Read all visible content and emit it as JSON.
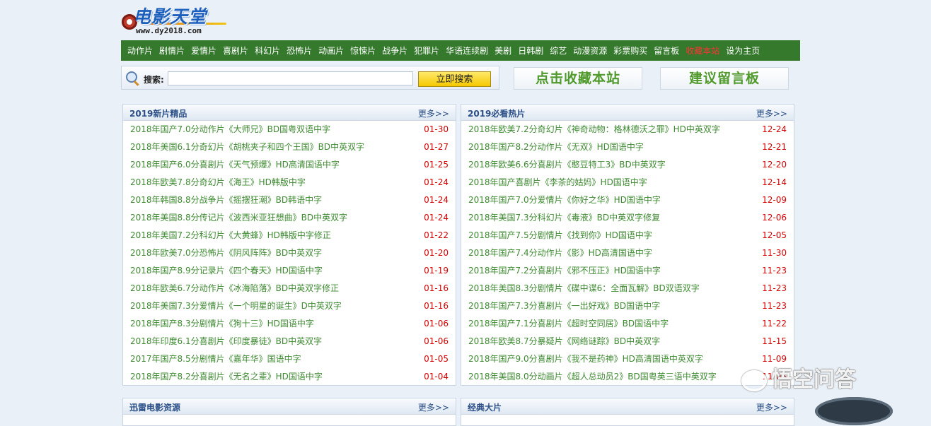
{
  "logo": {
    "title": "电影天堂",
    "url": "www.dy2018.com"
  },
  "nav": [
    {
      "label": "动作片"
    },
    {
      "label": "剧情片"
    },
    {
      "label": "爱情片"
    },
    {
      "label": "喜剧片"
    },
    {
      "label": "科幻片"
    },
    {
      "label": "恐怖片"
    },
    {
      "label": "动画片"
    },
    {
      "label": "惊悚片"
    },
    {
      "label": "战争片"
    },
    {
      "label": "犯罪片"
    },
    {
      "label": "华语连续剧"
    },
    {
      "label": "美剧"
    },
    {
      "label": "日韩剧"
    },
    {
      "label": "综艺"
    },
    {
      "label": "动漫资源"
    },
    {
      "label": "彩票购买"
    },
    {
      "label": "留言板"
    },
    {
      "label": "收藏本站",
      "highlight": true
    },
    {
      "label": "设为主页"
    }
  ],
  "search": {
    "label": "搜索:",
    "value": "",
    "placeholder": "",
    "button": "立即搜索"
  },
  "bookmark_label": "点击收藏本站",
  "guestbook_label": "建议留言板",
  "panels": [
    {
      "title": "2019新片精品",
      "more": "更多>>",
      "items": [
        {
          "title": "2018年国产7.0分动作片《大师兄》BD国粤双语中字",
          "date": "01-30"
        },
        {
          "title": "2018年美国6.1分奇幻片《胡桃夹子和四个王国》BD中英双字",
          "date": "01-27"
        },
        {
          "title": "2018年国产6.0分喜剧片《天气预爆》HD高清国语中字",
          "date": "01-25"
        },
        {
          "title": "2018年欧美7.8分奇幻片《海王》HD韩版中字",
          "date": "01-24"
        },
        {
          "title": "2018年韩国8.8分战争片《摇摆狂潮》BD韩语中字",
          "date": "01-24"
        },
        {
          "title": "2018年美国8.8分传记片《波西米亚狂想曲》BD中英双字",
          "date": "01-24"
        },
        {
          "title": "2018年美国7.2分科幻片《大黄蜂》HD韩版中字修正",
          "date": "01-22"
        },
        {
          "title": "2018年欧美7.0分恐怖片《阴风阵阵》BD中英双字",
          "date": "01-20"
        },
        {
          "title": "2018年国产8.9分记录片《四个春天》HD国语中字",
          "date": "01-19"
        },
        {
          "title": "2018年欧美6.7分动作片《冰海陷落》BD中英双字修正",
          "date": "01-16"
        },
        {
          "title": "2018年美国7.3分爱情片《一个明星的诞生》D中英双字",
          "date": "01-16"
        },
        {
          "title": "2018年国产8.3分剧情片《狗十三》HD国语中字",
          "date": "01-06"
        },
        {
          "title": "2018年印度6.1分喜剧片《印度暴徒》BD中英双字",
          "date": "01-06"
        },
        {
          "title": "2017年国产8.5分剧情片《嘉年华》国语中字",
          "date": "01-05"
        },
        {
          "title": "2018年国产8.2分喜剧片《无名之辈》HD国语中字",
          "date": "01-04"
        }
      ]
    },
    {
      "title": "2019必看热片",
      "more": "更多>>",
      "items": [
        {
          "title": "2018年欧美7.2分奇幻片《神奇动物：格林德沃之罪》HD中英双字",
          "date": "12-24"
        },
        {
          "title": "2018年国产8.2分动作片《无双》HD国语中字",
          "date": "12-21"
        },
        {
          "title": "2018年欧美6.6分喜剧片《憨豆特工3》BD中英双字",
          "date": "12-20"
        },
        {
          "title": "2018年国产喜剧片《李茶的姑妈》HD国语中字",
          "date": "12-14"
        },
        {
          "title": "2018年国产7.0分爱情片《你好之华》HD国语中字",
          "date": "12-09"
        },
        {
          "title": "2018年美国7.3分科幻片《毒液》BD中英双字修复",
          "date": "12-06"
        },
        {
          "title": "2018年国产7.5分剧情片《找到你》HD国语中字",
          "date": "12-05"
        },
        {
          "title": "2018年国产7.4分动作片《影》HD高清国语中字",
          "date": "11-30"
        },
        {
          "title": "2018年国产7.2分喜剧片《邪不压正》HD国语中字",
          "date": "11-23"
        },
        {
          "title": "2018年美国8.3分剧情片《碟中谍6：全面瓦解》BD双语双字",
          "date": "11-23"
        },
        {
          "title": "2018年国产7.3分喜剧片《一出好戏》BD国语中字",
          "date": "11-23"
        },
        {
          "title": "2018年国产7.1分喜剧片《超时空同居》BD国语中字",
          "date": "11-22"
        },
        {
          "title": "2018年欧美8.7分暴疑片《网络谜踪》BD中英双字",
          "date": "11-15"
        },
        {
          "title": "2018年国产9.0分喜剧片《我不是药神》HD高清国语中英双字",
          "date": "11-09"
        },
        {
          "title": "2018年美国8.0分动画片《超人总动员2》BD国粤英三语中英双字",
          "date": "11-05"
        }
      ]
    }
  ],
  "bottom_panels": [
    {
      "title": "迅雷电影资源",
      "more": "更多>>"
    },
    {
      "title": "经典大片",
      "more": "更多>>"
    }
  ],
  "watermark": "悟空问答"
}
